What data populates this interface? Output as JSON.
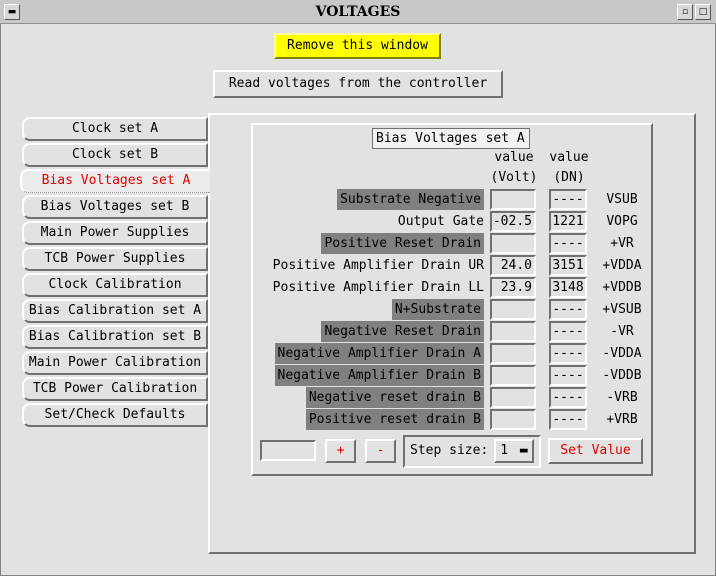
{
  "window": {
    "title": "VOLTAGES"
  },
  "buttons": {
    "remove": "Remove this window",
    "read": "Read voltages from the controller"
  },
  "tabs": [
    {
      "label": "Clock set A"
    },
    {
      "label": "Clock set B"
    },
    {
      "label": "Bias Voltages set A"
    },
    {
      "label": "Bias Voltages set B"
    },
    {
      "label": "Main Power Supplies"
    },
    {
      "label": "TCB Power Supplies"
    },
    {
      "label": "Clock Calibration"
    },
    {
      "label": "Bias Calibration set A"
    },
    {
      "label": "Bias Calibration set B"
    },
    {
      "label": "Main Power Calibration"
    },
    {
      "label": "TCB Power Calibration"
    },
    {
      "label": "Set/Check Defaults"
    }
  ],
  "active_tab": "Bias Voltages set A",
  "group": {
    "title": "Bias Voltages set A"
  },
  "columns": {
    "value1": "value",
    "value1_unit": "(Volt)",
    "value2": "value",
    "value2_unit": "(DN)"
  },
  "rows": [
    {
      "label": "Substrate Negative",
      "volt": "",
      "dn": "----",
      "signal": "VSUB"
    },
    {
      "label": "Output Gate",
      "volt": "-02.5",
      "dn": "1221",
      "signal": "VOPG"
    },
    {
      "label": "Positive Reset Drain",
      "volt": "",
      "dn": "----",
      "signal": "+VR"
    },
    {
      "label": "Positive Amplifier Drain UR",
      "volt": "24.0",
      "dn": "3151",
      "signal": "+VDDA"
    },
    {
      "label": "Positive Amplifier Drain LL",
      "volt": "23.9",
      "dn": "3148",
      "signal": "+VDDB"
    },
    {
      "label": "N+Substrate",
      "volt": "",
      "dn": "----",
      "signal": "+VSUB"
    },
    {
      "label": "Negative Reset Drain",
      "volt": "",
      "dn": "----",
      "signal": "-VR"
    },
    {
      "label": "Negative Amplifier Drain A",
      "volt": "",
      "dn": "----",
      "signal": "-VDDA"
    },
    {
      "label": "Negative Amplifier Drain B",
      "volt": "",
      "dn": "----",
      "signal": "-VDDB"
    },
    {
      "label": "Negative reset drain B",
      "volt": "",
      "dn": "----",
      "signal": "-VRB"
    },
    {
      "label": "Positive reset drain B",
      "volt": "",
      "dn": "----",
      "signal": "+VRB"
    }
  ],
  "controls": {
    "plus": "+",
    "minus": "-",
    "step_label": "Step size:",
    "step_value": "1",
    "set_value": "Set Value"
  },
  "colors": {
    "highlight": "#ffff00",
    "active_text": "#e00000",
    "label_bg": "#808080"
  }
}
